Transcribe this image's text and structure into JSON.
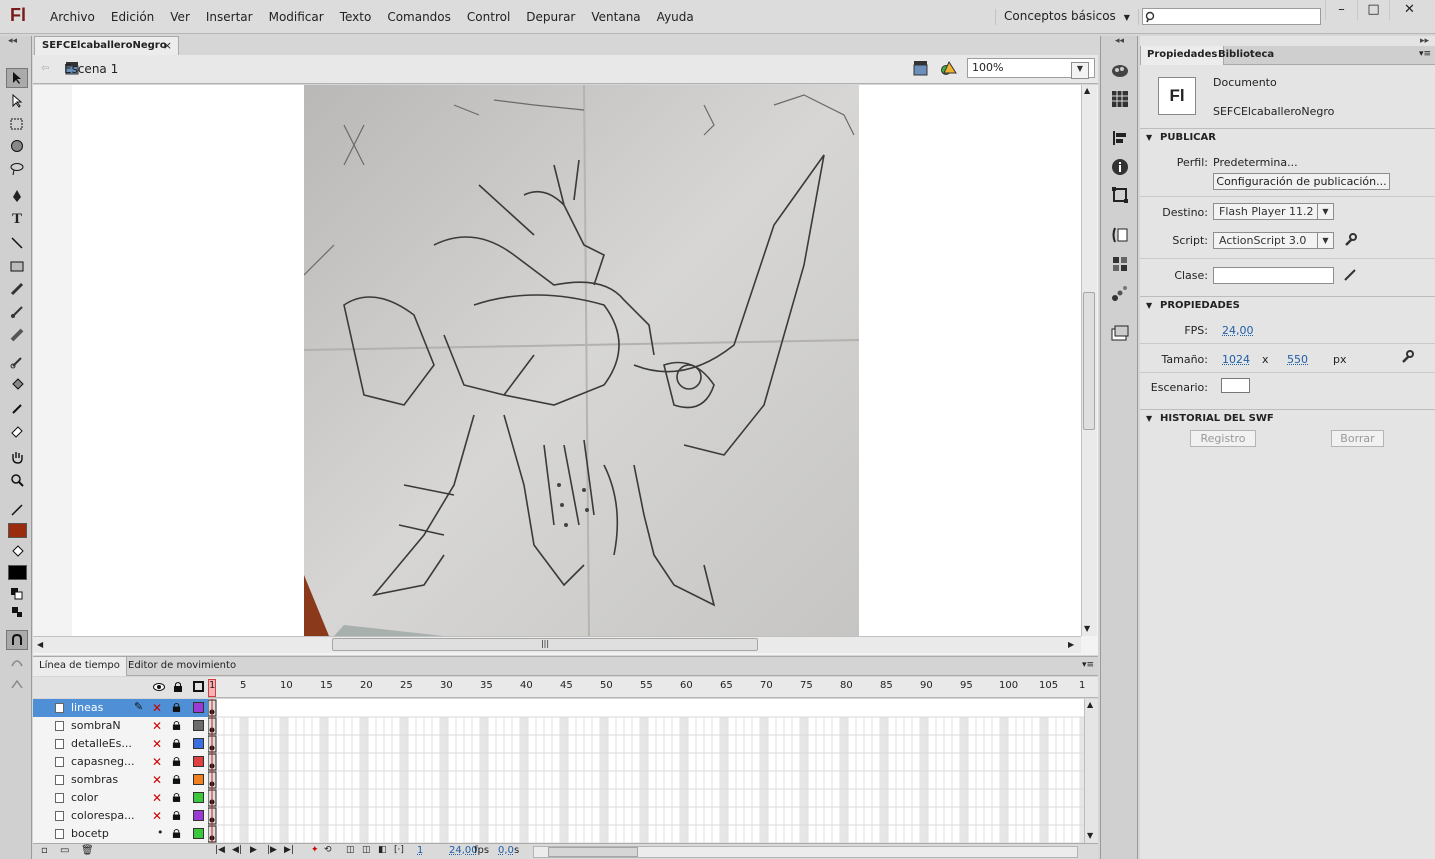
{
  "app": {
    "logo": "Fl"
  },
  "menu": [
    "Archivo",
    "Edición",
    "Ver",
    "Insertar",
    "Modificar",
    "Texto",
    "Comandos",
    "Control",
    "Depurar",
    "Ventana",
    "Ayuda"
  ],
  "workspace": "Conceptos básicos",
  "window_buttons": {
    "minimize": "–",
    "maximize": "□",
    "close": "✕"
  },
  "document": {
    "tab": "SEFCElcaballeroNegro",
    "tab_close": "×",
    "scene": "Escena 1",
    "zoom": "100%"
  },
  "timeline": {
    "tabs": [
      "Línea de tiempo",
      "Editor de movimiento"
    ],
    "frame_numbers": [
      "1",
      "5",
      "10",
      "15",
      "20",
      "25",
      "30",
      "35",
      "40",
      "45",
      "50",
      "55",
      "60",
      "65",
      "70",
      "75",
      "80",
      "85",
      "90",
      "95",
      "100",
      "105",
      "1"
    ],
    "layers": [
      {
        "name": "lineas",
        "color": "#9b3bd6",
        "selected": true
      },
      {
        "name": "sombraN",
        "color": "#6b6b6b",
        "selected": false
      },
      {
        "name": "detalleEs...",
        "color": "#3b6fe0",
        "selected": false
      },
      {
        "name": "capasneg...",
        "color": "#e04040",
        "selected": false
      },
      {
        "name": "sombras",
        "color": "#f08020",
        "selected": false
      },
      {
        "name": "color",
        "color": "#3cc83c",
        "selected": false
      },
      {
        "name": "colorespa...",
        "color": "#9b3bd6",
        "selected": false
      },
      {
        "name": "bocetp",
        "color": "#3cc83c",
        "selected": false
      }
    ],
    "current_frame": "1",
    "fps": "24,00",
    "fps_unit": "fps",
    "time": "0,0",
    "time_unit": "s"
  },
  "panel": {
    "tabs": [
      "Propiedades",
      "Biblioteca"
    ],
    "doc_icon": "Fl",
    "doc_type": "Documento",
    "doc_name": "SEFCElcaballeroNegro",
    "publish": {
      "section": "PUBLICAR",
      "profile_label": "Perfil:",
      "profile": "Predetermina...",
      "config_button": "Configuración de publicación...",
      "target_label": "Destino:",
      "target": "Flash Player 11.2",
      "script_label": "Script:",
      "script": "ActionScript 3.0",
      "class_label": "Clase:"
    },
    "properties": {
      "section": "PROPIEDADES",
      "fps_label": "FPS:",
      "fps": "24,00",
      "size_label": "Tamaño:",
      "width": "1024",
      "x": "x",
      "height": "550",
      "unit": "px",
      "stage_label": "Escenario:",
      "stage_color": "#ffffff"
    },
    "swf_history": {
      "section": "HISTORIAL DEL SWF",
      "log_button": "Registro",
      "clear_button": "Borrar"
    }
  },
  "colors": {
    "stroke": "#9a2b0e",
    "fill": "#000000",
    "selection": "#4f8fd6"
  }
}
